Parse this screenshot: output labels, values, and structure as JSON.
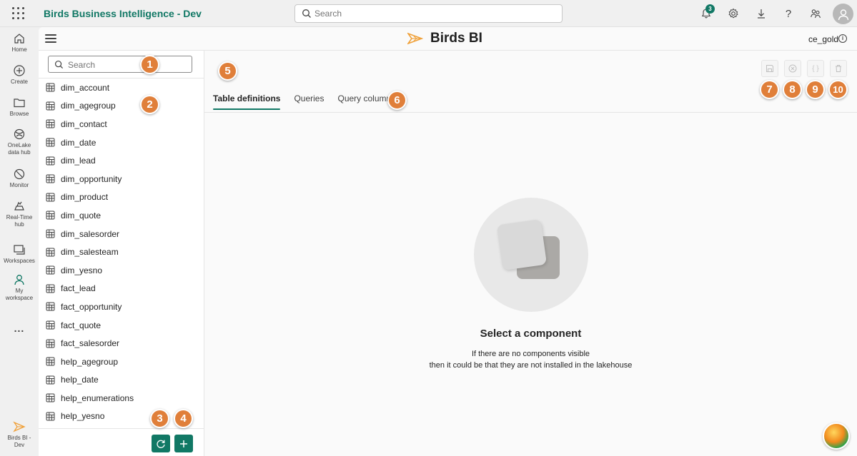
{
  "topbar": {
    "app_title": "Birds Business Intelligence - Dev",
    "search_placeholder": "Search",
    "notification_count": "3"
  },
  "leftnav": {
    "items": [
      {
        "label": "Home",
        "icon": "home-icon"
      },
      {
        "label": "Create",
        "icon": "create-icon"
      },
      {
        "label": "Browse",
        "icon": "browse-icon"
      },
      {
        "label": "OneLake data hub",
        "icon": "onelake-icon"
      },
      {
        "label": "Monitor",
        "icon": "monitor-icon"
      },
      {
        "label": "Real-Time hub",
        "icon": "realtime-icon"
      },
      {
        "label": "Workspaces",
        "icon": "workspaces-icon"
      },
      {
        "label": "My workspace",
        "icon": "my-workspace-icon"
      }
    ],
    "more": "...",
    "bottom_app": "Birds BI - Dev"
  },
  "header": {
    "brand": "Birds BI",
    "user": "ce_gold",
    "info": "i"
  },
  "panel": {
    "search_placeholder": "Search",
    "tables": [
      "dim_account",
      "dim_agegroup",
      "dim_contact",
      "dim_date",
      "dim_lead",
      "dim_opportunity",
      "dim_product",
      "dim_quote",
      "dim_salesorder",
      "dim_salesteam",
      "dim_yesno",
      "fact_lead",
      "fact_opportunity",
      "fact_quote",
      "fact_salesorder",
      "help_agegroup",
      "help_date",
      "help_enumerations",
      "help_yesno"
    ]
  },
  "tabs": [
    {
      "label": "Table definitions",
      "active": true
    },
    {
      "label": "Queries",
      "active": false
    },
    {
      "label": "Query columns",
      "active": false
    }
  ],
  "toolbar": {
    "json_label": "{ }"
  },
  "empty_state": {
    "title": "Select a component",
    "line1": "If there are no components visible",
    "line2": "then it could be that they are not installed in the lakehouse"
  },
  "callouts": [
    "1",
    "2",
    "3",
    "4",
    "5",
    "6",
    "7",
    "8",
    "9",
    "10"
  ],
  "colors": {
    "accent": "#117865",
    "callout": "#e07f3a"
  }
}
